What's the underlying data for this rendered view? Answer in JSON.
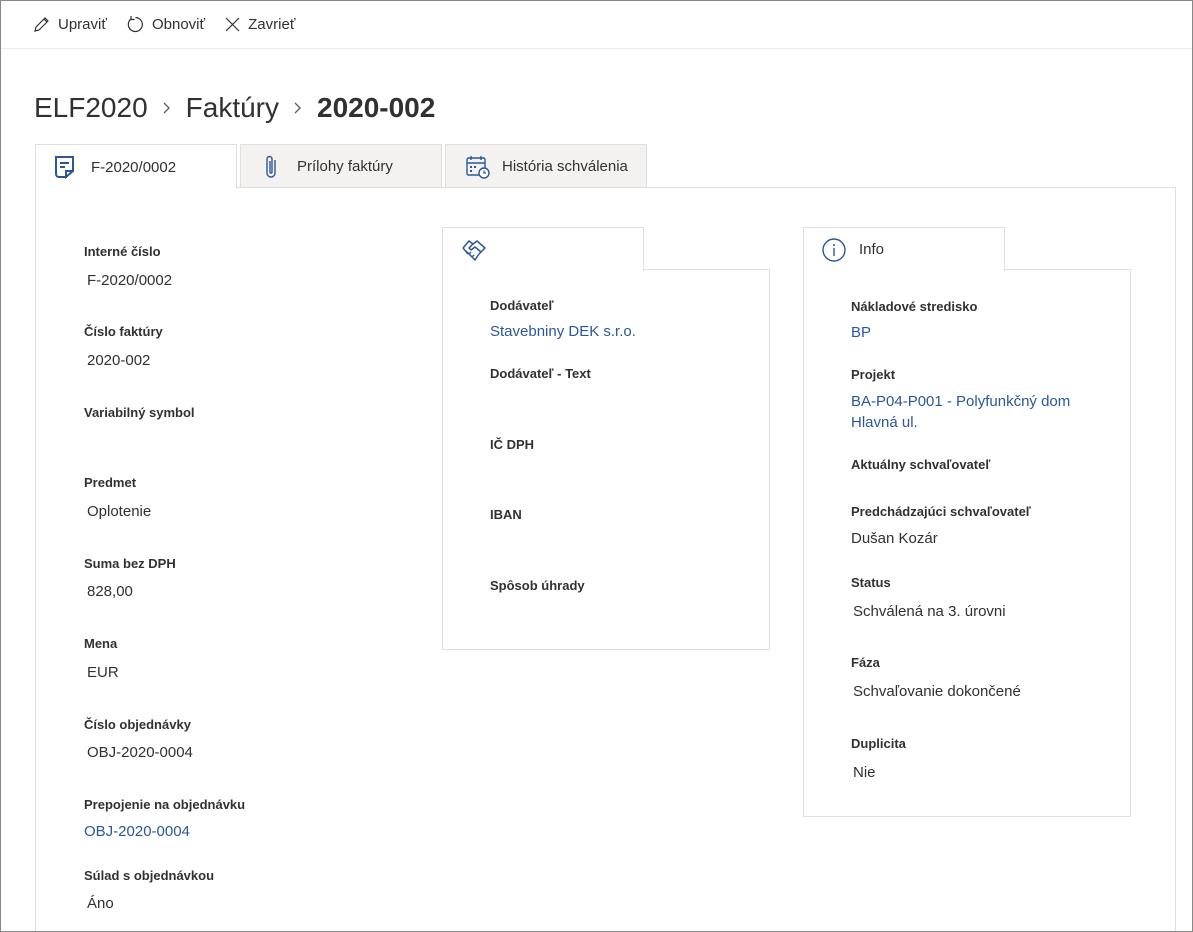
{
  "toolbar": {
    "edit_label": "Upraviť",
    "refresh_label": "Obnoviť",
    "close_label": "Zavrieť"
  },
  "breadcrumb": {
    "items": [
      "ELF2020",
      "Faktúry",
      "2020-002"
    ]
  },
  "tabs": [
    {
      "label": "F-2020/0002",
      "icon": "invoice-icon"
    },
    {
      "label": "Prílohy faktúry",
      "icon": "paperclip-icon"
    },
    {
      "label": "História schválenia",
      "icon": "calendar-clock-icon"
    }
  ],
  "left_fields": [
    {
      "label": "Interné číslo",
      "value": "F-2020/0002"
    },
    {
      "label": "Číslo faktúry",
      "value": "2020-002"
    },
    {
      "label": "Variabilný symbol",
      "value": ""
    },
    {
      "label": "Predmet",
      "value": "Oplotenie"
    },
    {
      "label": "Suma bez DPH",
      "value": "828,00"
    },
    {
      "label": "Mena",
      "value": "EUR"
    },
    {
      "label": "Číslo objednávky",
      "value": "OBJ-2020-0004"
    },
    {
      "label": "Prepojenie na objednávku",
      "value": "OBJ-2020-0004"
    },
    {
      "label": "Súlad s objednávkou",
      "value": "Áno"
    }
  ],
  "supplier_card": {
    "icon": "handshake-icon",
    "fields": [
      {
        "label": "Dodávateľ",
        "value": "Stavebniny DEK s.r.o."
      },
      {
        "label": "Dodávateľ - Text",
        "value": ""
      },
      {
        "label": "IČ DPH",
        "value": ""
      },
      {
        "label": "IBAN",
        "value": ""
      },
      {
        "label": "Spôsob úhrady",
        "value": ""
      }
    ]
  },
  "info_card": {
    "title": "Info",
    "icon": "info-icon",
    "fields": [
      {
        "label": "Nákladové stredisko",
        "value": "BP"
      },
      {
        "label": "Projekt",
        "value_line1": "BA-P04-P001 - Polyfunkčný dom",
        "value_line2": "Hlavná ul."
      },
      {
        "label": "Aktuálny schvaľovateľ",
        "value": ""
      },
      {
        "label": "Predchádzajúci schvaľovateľ",
        "value": "Dušan Kozár"
      },
      {
        "label": "Status",
        "value": "Schválená na 3. úrovni"
      },
      {
        "label": "Fáza",
        "value": "Schvaľovanie dokončené"
      },
      {
        "label": "Duplicita",
        "value": "Nie"
      }
    ]
  },
  "colors": {
    "link": "#2b5797",
    "accent": "#2b5797",
    "text": "#323130",
    "border": "#e1dfdd"
  }
}
